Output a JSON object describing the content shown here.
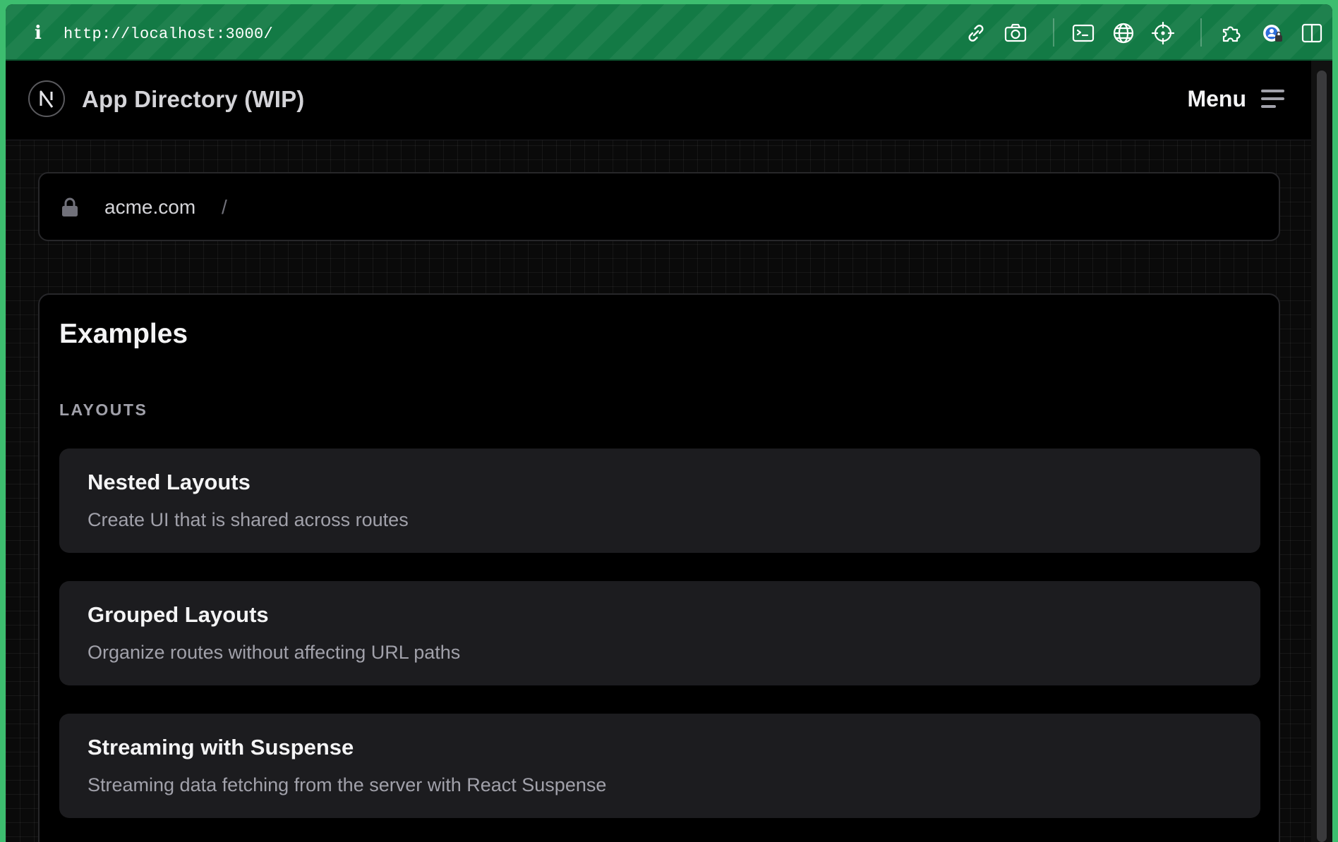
{
  "browser": {
    "info_glyph": "i",
    "url": "http://localhost:3000/",
    "toolbar_icons": [
      "link-icon",
      "camera-icon",
      "terminal-icon",
      "globe-icon",
      "crosshair-icon",
      "extensions-icon",
      "profile-icon",
      "sidebar-icon"
    ]
  },
  "header": {
    "logo_letter": "N",
    "title": "App Directory (WIP)",
    "menu_label": "Menu"
  },
  "address": {
    "domain": "acme.com",
    "separator": "/"
  },
  "main": {
    "heading": "Examples",
    "section_label": "LAYOUTS",
    "items": [
      {
        "title": "Nested Layouts",
        "description": "Create UI that is shared across routes"
      },
      {
        "title": "Grouped Layouts",
        "description": "Organize routes without affecting URL paths"
      },
      {
        "title": "Streaming with Suspense",
        "description": "Streaming data fetching from the server with React Suspense"
      }
    ]
  },
  "colors": {
    "toolbar_green": "#137a45",
    "background": "#000000",
    "card": "#1c1c1f",
    "text_primary": "#f4f4f5",
    "text_muted": "#a1a1aa"
  }
}
